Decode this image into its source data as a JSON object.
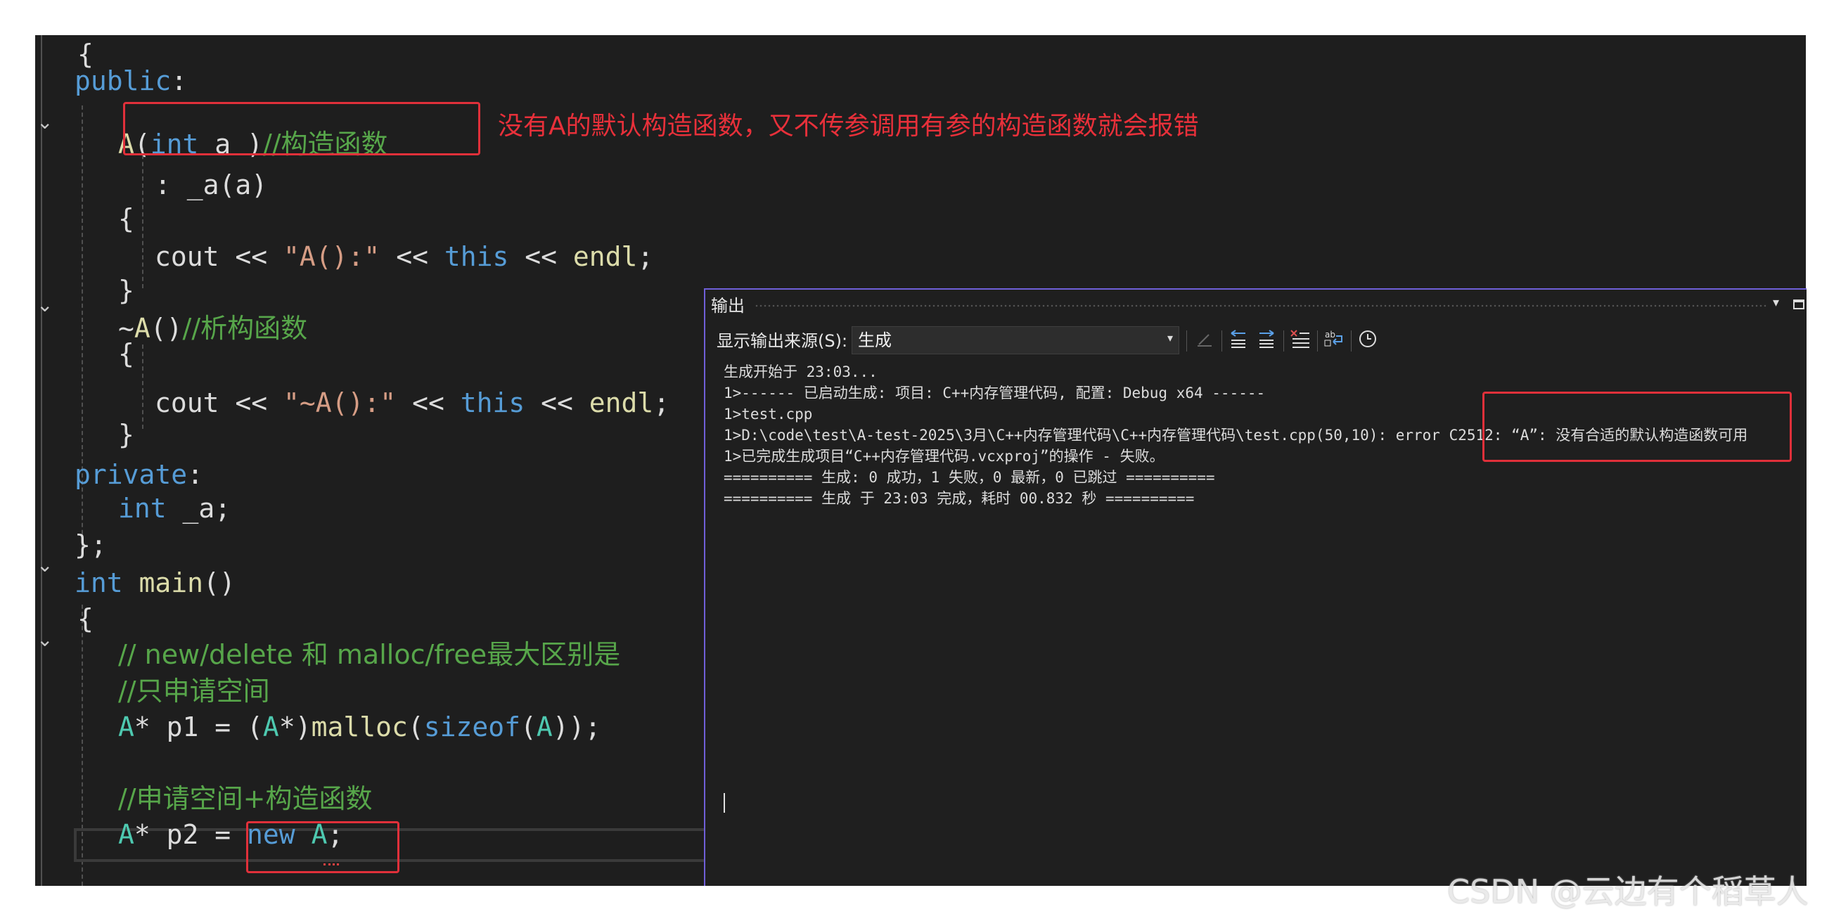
{
  "editor": {
    "lines": [
      [
        [
          "pl",
          "{"
        ]
      ],
      [
        [
          "kw",
          "public"
        ],
        [
          "pl",
          ":"
        ]
      ],
      [
        [
          "fn",
          "A"
        ],
        [
          "pl",
          "("
        ],
        [
          "kw",
          "int"
        ],
        [
          "pl",
          " a )"
        ],
        [
          "cm",
          "//构造函数"
        ]
      ],
      [
        [
          "pl",
          ": _a(a)"
        ]
      ],
      [
        [
          "pl",
          "{"
        ]
      ],
      [
        [
          "pl",
          "cout << "
        ],
        [
          "st",
          "\"A():\""
        ],
        [
          "pl",
          " << "
        ],
        [
          "kw",
          "this"
        ],
        [
          "pl",
          " << "
        ],
        [
          "fn",
          "endl"
        ],
        [
          "pl",
          ";"
        ]
      ],
      [
        [
          "pl",
          "}"
        ]
      ],
      [
        [
          "pl",
          "~"
        ],
        [
          "fn",
          "A"
        ],
        [
          "pl",
          "()"
        ],
        [
          "cm",
          "//析构函数"
        ]
      ],
      [
        [
          "pl",
          "{"
        ]
      ],
      [
        [
          "pl",
          "cout << "
        ],
        [
          "st",
          "\"~A():\""
        ],
        [
          "pl",
          " << "
        ],
        [
          "kw",
          "this"
        ],
        [
          "pl",
          " << "
        ],
        [
          "fn",
          "endl"
        ],
        [
          "pl",
          ";"
        ]
      ],
      [
        [
          "pl",
          "}"
        ]
      ],
      [
        [
          "kw",
          "private"
        ],
        [
          "pl",
          ":"
        ]
      ],
      [
        [
          "kw",
          "int"
        ],
        [
          "pl",
          " _a;"
        ]
      ],
      [
        [
          "pl",
          "};"
        ]
      ],
      [
        [
          "kw",
          "int"
        ],
        [
          "pl",
          " "
        ],
        [
          "fn",
          "main"
        ],
        [
          "pl",
          "()"
        ]
      ],
      [
        [
          "pl",
          "{"
        ]
      ],
      [
        [
          "cm",
          "// new/delete 和 malloc/free最大区别是"
        ]
      ],
      [
        [
          "cm",
          "//只申请空间"
        ]
      ],
      [
        [
          "ty",
          "A"
        ],
        [
          "pl",
          "* p1 = ("
        ],
        [
          "ty",
          "A"
        ],
        [
          "pl",
          "*)"
        ],
        [
          "fn",
          "malloc"
        ],
        [
          "pl",
          "("
        ],
        [
          "kw",
          "sizeof"
        ],
        [
          "pl",
          "("
        ],
        [
          "ty",
          "A"
        ],
        [
          "pl",
          "));"
        ]
      ],
      [
        [
          "pl",
          ""
        ]
      ],
      [
        [
          "cm",
          "//申请空间+构造函数"
        ]
      ],
      [
        [
          "ty",
          "A"
        ],
        [
          "pl",
          "* p2 = "
        ],
        [
          "kw",
          "new"
        ],
        [
          "pl",
          " "
        ],
        [
          "ty",
          "A"
        ],
        [
          "pl",
          ";"
        ]
      ]
    ]
  },
  "annotation": "没有A的默认构造函数，又不传参调用有参的构造函数就会报错",
  "output": {
    "title": "输出",
    "source_label": "显示输出来源(S):",
    "source_value": "生成",
    "toolbar_icons": [
      "find-message-icon",
      "prev-message-icon",
      "next-message-icon",
      "clear-all-icon",
      "word-wrap-icon",
      "timestamp-icon"
    ],
    "lines": [
      "生成开始于 23:03...",
      "1>------ 已启动生成: 项目: C++内存管理代码, 配置: Debug x64 ------",
      "1>test.cpp",
      "1>D:\\code\\test\\A-test-2025\\3月\\C++内存管理代码\\C++内存管理代码\\test.cpp(50,10): error C2512: “A”: 没有合适的默认构造函数可用",
      "1>已完成生成项目“C++内存管理代码.vcxproj”的操作 - 失败。",
      "========== 生成: 0 成功，1 失败，0 最新，0 已跳过 ==========",
      "========== 生成 于 23:03 完成，耗时 00.832 秒 =========="
    ]
  },
  "watermark": "CSDN @云边有个稻草人",
  "colors": {
    "keyword": "#569cd6",
    "type": "#4ec9b0",
    "function": "#dcdcaa",
    "comment": "#57a64a",
    "string": "#d69d85",
    "annotation_red": "#e8303a",
    "output_border": "#6f5fd8"
  }
}
